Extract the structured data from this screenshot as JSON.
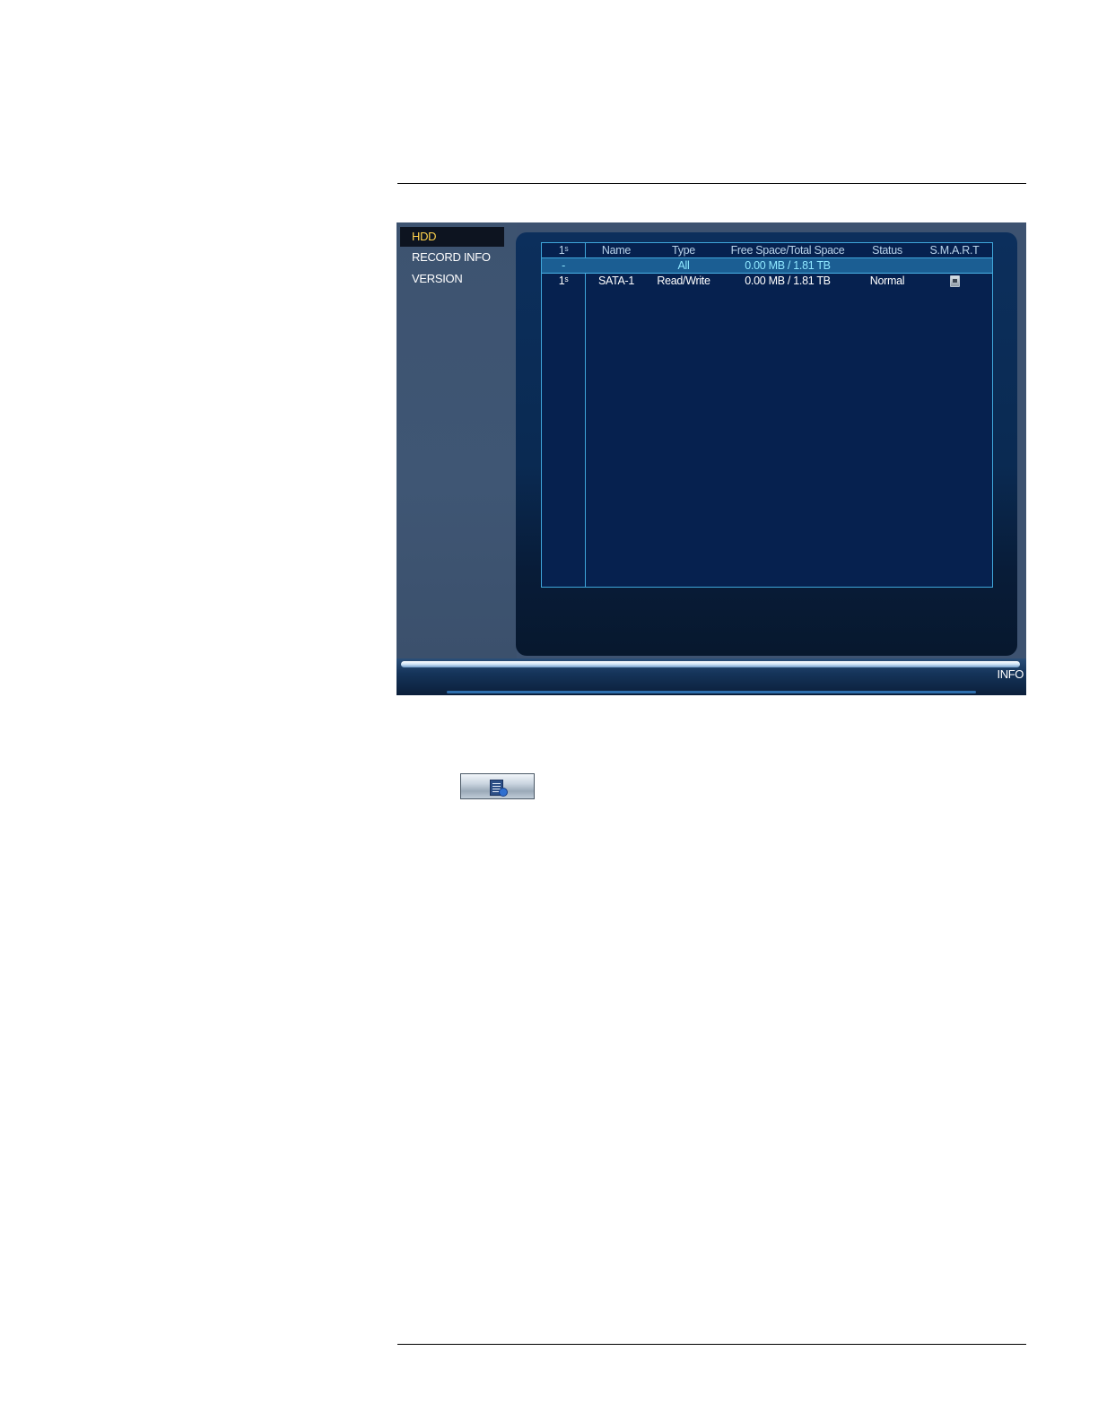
{
  "sidebar": {
    "items": [
      {
        "label": "HDD",
        "active": true
      },
      {
        "label": "RECORD INFO",
        "active": false
      },
      {
        "label": "VERSION",
        "active": false
      }
    ]
  },
  "hdd_table": {
    "headers": [
      "1ˢ",
      "Name",
      "Type",
      "Free Space/Total Space",
      "Status",
      "S.M.A.R.T"
    ],
    "rows": [
      {
        "num": "-",
        "name": "",
        "type": "All",
        "space": "0.00 MB / 1.81 TB",
        "status": "",
        "smart": ""
      },
      {
        "num": "1ˢ",
        "name": "SATA-1",
        "type": "Read/Write",
        "space": "0.00 MB / 1.81 TB",
        "status": "Normal",
        "smart": "smart-icon"
      }
    ]
  },
  "statusbar": {
    "label": "INFO"
  },
  "icons": {
    "toolbar_button": "document-gear-icon"
  },
  "colors": {
    "active_menu_text": "#ffd34d",
    "table_border": "#3fa6da",
    "all_row_text": "#8fe7ff"
  }
}
